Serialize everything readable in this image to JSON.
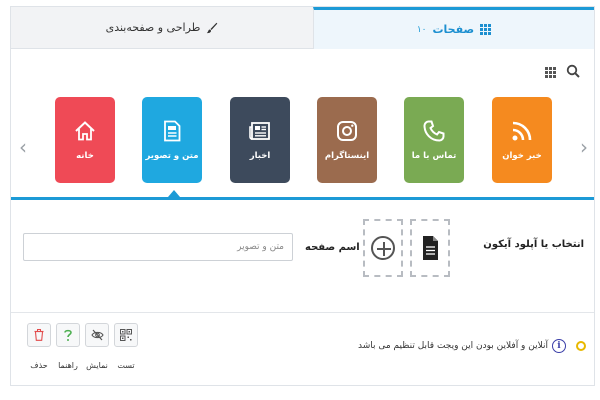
{
  "tabs": {
    "pages_label": "صفحات",
    "pages_count": "۱۰",
    "design_label": "طراحی و صفحه‌بندی"
  },
  "carousel": {
    "items": [
      {
        "label": "خبر خوان",
        "color": "#f58a1f",
        "icon": "rss-icon"
      },
      {
        "label": "تماس با ما",
        "color": "#7aaa53",
        "icon": "phone-icon"
      },
      {
        "label": "اینستاگرام",
        "color": "#9b6b4e",
        "icon": "instagram-icon"
      },
      {
        "label": "اخبار",
        "color": "#3d4a5c",
        "icon": "newspaper-icon"
      },
      {
        "label": "متن و تصویر",
        "color": "#1fa8e0",
        "icon": "document-icon",
        "selected": true
      },
      {
        "label": "خانه",
        "color": "#ef4a56",
        "icon": "home-icon"
      }
    ]
  },
  "form": {
    "icon_upload_label": "انتخاب یا آپلود آیکون",
    "page_name_label": "اسم صفحه",
    "page_name_placeholder": "متن و تصویر"
  },
  "footer": {
    "note": "آنلاین و آفلاین بودن این ویجت قابل تنظیم می باشد",
    "actions": [
      {
        "label": "تست",
        "icon": "qr-icon"
      },
      {
        "label": "نمایش",
        "icon": "eye-off-icon"
      },
      {
        "label": "راهنما",
        "icon": "help-icon"
      },
      {
        "label": "حذف",
        "icon": "trash-icon"
      }
    ]
  },
  "colors": {
    "accent": "#1c9ad6",
    "info": "#3b3fa8",
    "warning": "#e8b800",
    "danger": "#e24b4b",
    "success": "#4caf50"
  }
}
